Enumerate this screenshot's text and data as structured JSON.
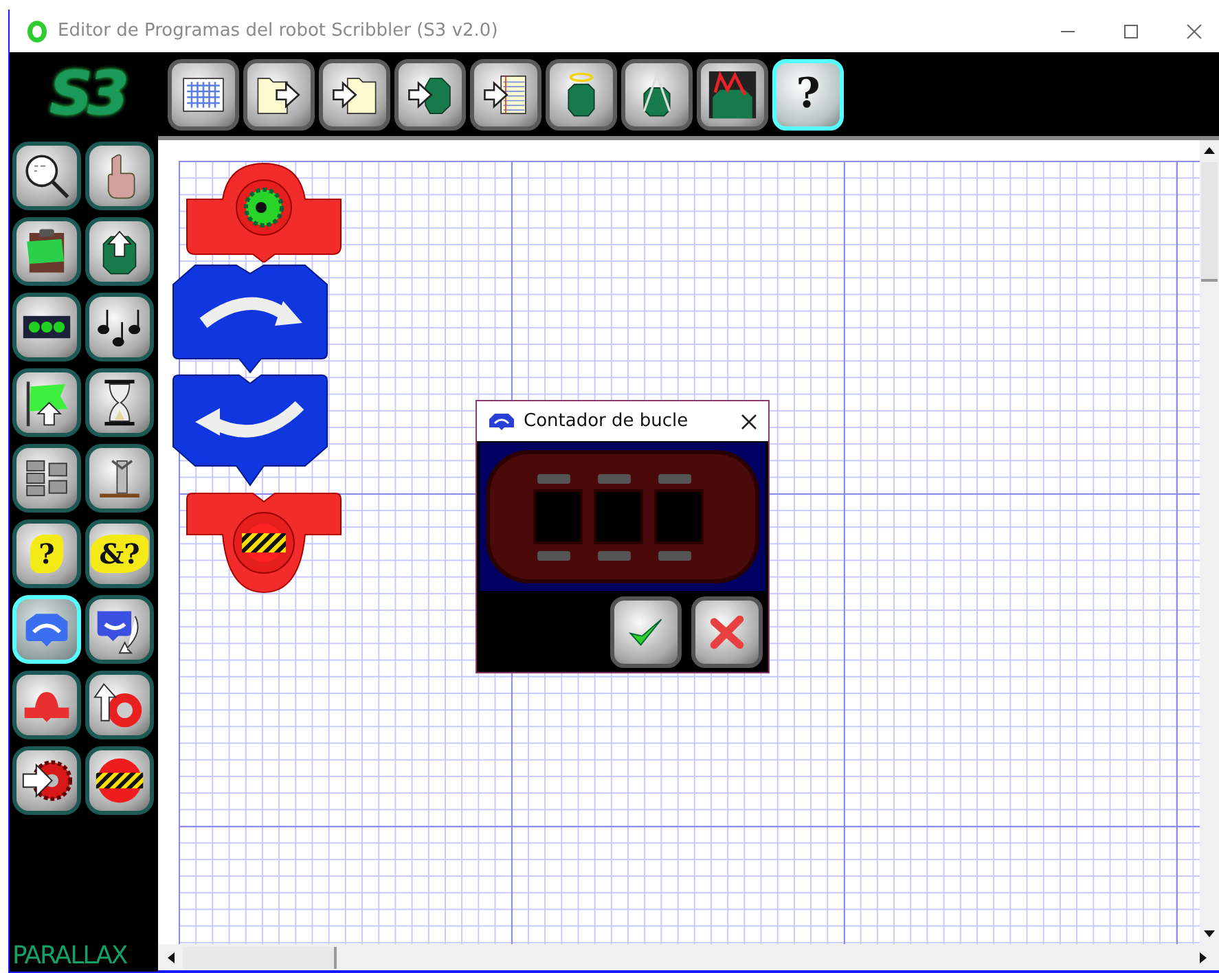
{
  "window": {
    "title": "Editor de Programas del robot Scribbler (S3 v2.0)"
  },
  "logo": {
    "text": "S3"
  },
  "toolbar": [
    {
      "kind": "new",
      "selected": false
    },
    {
      "kind": "open",
      "selected": false
    },
    {
      "kind": "save",
      "selected": false
    },
    {
      "kind": "download",
      "selected": false
    },
    {
      "kind": "import",
      "selected": false
    },
    {
      "kind": "run",
      "selected": false
    },
    {
      "kind": "calibrate",
      "selected": false
    },
    {
      "kind": "monitor",
      "selected": false
    },
    {
      "kind": "help",
      "label": "?",
      "selected": true
    }
  ],
  "palette": [
    {
      "kind": "zoom",
      "selected": false
    },
    {
      "kind": "pointer",
      "selected": false
    },
    {
      "kind": "clipboard",
      "selected": false
    },
    {
      "kind": "upload",
      "selected": false
    },
    {
      "kind": "leds",
      "selected": false
    },
    {
      "kind": "music",
      "selected": false
    },
    {
      "kind": "flag",
      "selected": false
    },
    {
      "kind": "timer",
      "selected": false
    },
    {
      "kind": "motors",
      "selected": false
    },
    {
      "kind": "sensors",
      "selected": false
    },
    {
      "kind": "if",
      "label": "?",
      "selected": false
    },
    {
      "kind": "condition",
      "label": "&?",
      "selected": false
    },
    {
      "kind": "loop",
      "selected": true
    },
    {
      "kind": "loop_return",
      "selected": false
    },
    {
      "kind": "subroutine",
      "selected": false
    },
    {
      "kind": "return",
      "selected": false
    },
    {
      "kind": "goto",
      "selected": false
    },
    {
      "kind": "stop",
      "selected": false
    }
  ],
  "brand": {
    "text": "PARALLAX"
  },
  "program": [
    {
      "kind": "start"
    },
    {
      "kind": "loop_begin"
    },
    {
      "kind": "loop_end"
    },
    {
      "kind": "end"
    }
  ],
  "dialog": {
    "title": "Contador de bucle"
  }
}
